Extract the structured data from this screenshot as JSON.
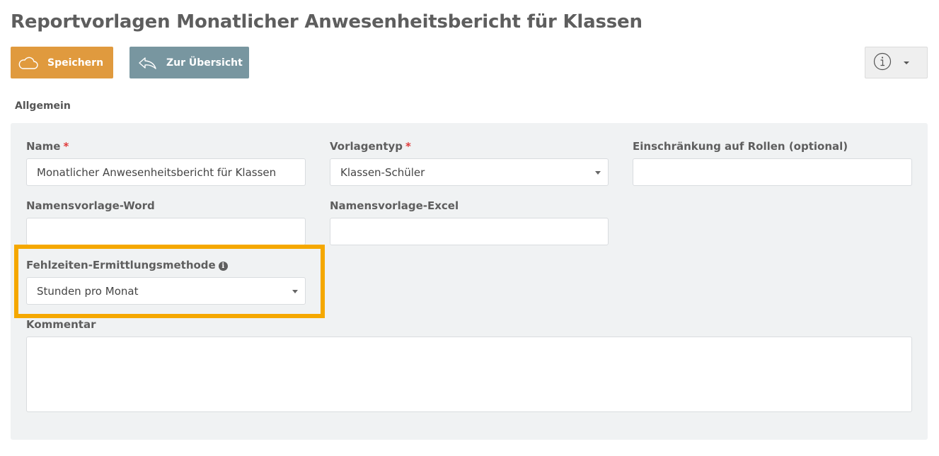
{
  "page": {
    "title": "Reportvorlagen Monatlicher Anwesenheitsbericht für Klassen"
  },
  "toolbar": {
    "save_label": "Speichern",
    "back_label": "Zur Übersicht",
    "save_icon": "cloud-icon",
    "back_icon": "reply-arrow-icon",
    "info_icon": "info-icon"
  },
  "section": {
    "label": "Allgemein"
  },
  "form": {
    "name": {
      "label": "Name",
      "required_mark": "*",
      "value": "Monatlicher Anwesenheitsbericht für Klassen"
    },
    "template_type": {
      "label": "Vorlagentyp",
      "required_mark": "*",
      "value": "Klassen-Schüler"
    },
    "role_restriction": {
      "label": "Einschränkung auf Rollen (optional)",
      "value": ""
    },
    "word_name_template": {
      "label": "Namensvorlage-Word",
      "value": ""
    },
    "excel_name_template": {
      "label": "Namensvorlage-Excel",
      "value": ""
    },
    "absence_method": {
      "label": "Fehlzeiten-Ermittlungsmethode",
      "value": "Stunden pro Monat",
      "info_glyph": "i"
    },
    "comment": {
      "label": "Kommentar",
      "value": ""
    }
  },
  "colors": {
    "save_button": "#e09a3e",
    "back_button": "#7896a0",
    "highlight": "#f5a800",
    "required": "#e03a3a",
    "panel": "#f0f2f3"
  }
}
